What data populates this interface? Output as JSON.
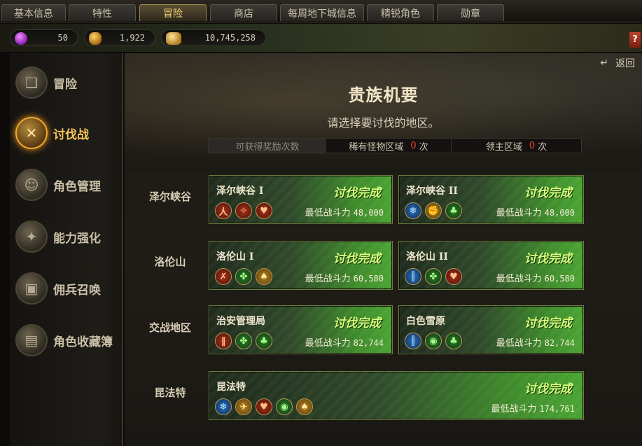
{
  "tabs": [
    {
      "label": "基本信息"
    },
    {
      "label": "特性"
    },
    {
      "label": "冒险"
    },
    {
      "label": "商店"
    },
    {
      "label": "每周地下城信息"
    },
    {
      "label": "精锐角色"
    },
    {
      "label": "勋章"
    }
  ],
  "active_tab": "冒险",
  "currency": {
    "gems": "50",
    "gold": "1,922",
    "coins": "10,745,258"
  },
  "sidebar": {
    "items": [
      {
        "label": "冒险",
        "icon": "book-icon"
      },
      {
        "label": "讨伐战",
        "icon": "crossed-swords-icon"
      },
      {
        "label": "角色管理",
        "icon": "character-icon"
      },
      {
        "label": "能力强化",
        "icon": "shuriken-icon"
      },
      {
        "label": "佣兵召唤",
        "icon": "chest-icon"
      },
      {
        "label": "角色收藏簿",
        "icon": "album-icon"
      }
    ],
    "active": "讨伐战"
  },
  "main": {
    "back_label": "返回",
    "title": "贵族机要",
    "subtitle": "请选择要讨伐的地区。",
    "reward_bar": {
      "label": "可获得奖励次数",
      "rare_label": "稀有怪物区域",
      "rare_count": "0",
      "boss_label": "领主区域",
      "boss_count": "0",
      "unit": "次"
    }
  },
  "regions": [
    {
      "label": "泽尔峡谷"
    },
    {
      "label": "洛伦山"
    },
    {
      "label": "交战地区"
    },
    {
      "label": "昆法特"
    }
  ],
  "power_label": "最低战斗力",
  "status_label": "讨伐完成",
  "dungeons": [
    {
      "name": "泽尔峡谷 I",
      "power": "48,000",
      "icons": [
        "fire-spirit-icon",
        "flame-icon",
        "heart-icon"
      ]
    },
    {
      "name": "泽尔峡谷 II",
      "power": "48,000",
      "icons": [
        "ice-icon",
        "fist-icon",
        "clover-icon"
      ]
    },
    {
      "name": "洛伦山 I",
      "power": "60,580",
      "icons": [
        "slash-icon",
        "leaf-icon",
        "spade-icon"
      ]
    },
    {
      "name": "洛伦山 II",
      "power": "60,580",
      "icons": [
        "wave-icon",
        "leaf-icon",
        "heart-icon"
      ]
    },
    {
      "name": "治安管理局",
      "power": "82,744",
      "icons": [
        "flame-column-icon",
        "leaf-icon",
        "clover-icon"
      ]
    },
    {
      "name": "白色雪原",
      "power": "82,744",
      "icons": [
        "wave-icon",
        "eye-icon",
        "clover-icon"
      ]
    },
    {
      "name": "昆法特",
      "power": "174,761",
      "icons": [
        "ice-icon",
        "boot-icon",
        "heart-icon",
        "eye-icon",
        "spade-icon"
      ]
    }
  ],
  "colors": {
    "active_tab": "#f2d27a",
    "status_text": "#d5ff7d",
    "count_red": "#e6452f",
    "card_green": "#4aa532"
  }
}
